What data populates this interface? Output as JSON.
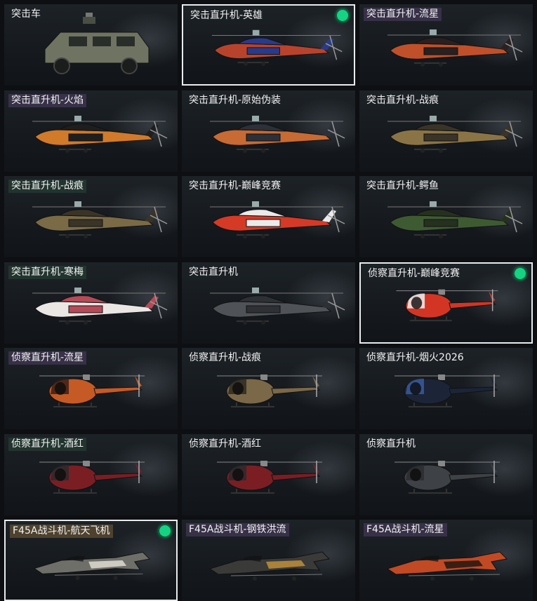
{
  "tiles": [
    {
      "label": "突击车",
      "kind": "truck",
      "tint": "plain",
      "selected": false,
      "badge": false,
      "c1": "#6e7461",
      "c2": "#4a4f43"
    },
    {
      "label": "突击直升机-英雄",
      "kind": "attack",
      "tint": "plain",
      "selected": true,
      "badge": true,
      "c1": "#b8432c",
      "c2": "#2a3a8a"
    },
    {
      "label": "突击直升机-流星",
      "kind": "attack",
      "tint": "purple",
      "selected": false,
      "badge": false,
      "c1": "#c0502a",
      "c2": "#2a2020"
    },
    {
      "label": "突击直升机-火焰",
      "kind": "attack",
      "tint": "purple",
      "selected": false,
      "badge": false,
      "c1": "#d07a2a",
      "c2": "#1e1e1e"
    },
    {
      "label": "突击直升机-原始伪装",
      "kind": "attack",
      "tint": "plain",
      "selected": false,
      "badge": false,
      "c1": "#c76a34",
      "c2": "#2c3038"
    },
    {
      "label": "突击直升机-战痕",
      "kind": "attack",
      "tint": "plain",
      "selected": false,
      "badge": false,
      "c1": "#8a7446",
      "c2": "#3a3428"
    },
    {
      "label": "突击直升机-战痕",
      "kind": "attack",
      "tint": "green",
      "selected": false,
      "badge": false,
      "c1": "#7a6a46",
      "c2": "#3a3428"
    },
    {
      "label": "突击直升机-巅峰竞赛",
      "kind": "attack",
      "tint": "plain",
      "selected": false,
      "badge": false,
      "c1": "#d43a26",
      "c2": "#eaeaea"
    },
    {
      "label": "突击直升机-鳄鱼",
      "kind": "attack",
      "tint": "plain",
      "selected": false,
      "badge": false,
      "c1": "#3e5a32",
      "c2": "#26301f"
    },
    {
      "label": "突击直升机-寒梅",
      "kind": "attack",
      "tint": "green",
      "selected": false,
      "badge": false,
      "c1": "#e9e6e4",
      "c2": "#b64a56"
    },
    {
      "label": "突击直升机",
      "kind": "attack",
      "tint": "plain",
      "selected": false,
      "badge": false,
      "c1": "#4f5358",
      "c2": "#2d3034"
    },
    {
      "label": "侦察直升机-巅峰竞赛",
      "kind": "scout",
      "tint": "plain",
      "selected": true,
      "badge": true,
      "c1": "#d33524",
      "c2": "#f1f1f1"
    },
    {
      "label": "侦察直升机-流星",
      "kind": "scout",
      "tint": "purple",
      "selected": false,
      "badge": false,
      "c1": "#c55a24",
      "c2": "#3a2018"
    },
    {
      "label": "侦察直升机-战痕",
      "kind": "scout",
      "tint": "plain",
      "selected": false,
      "badge": false,
      "c1": "#7b6848",
      "c2": "#2f2a22"
    },
    {
      "label": "侦察直升机-烟火2026",
      "kind": "scout",
      "tint": "plain",
      "selected": false,
      "badge": false,
      "c1": "#1c2438",
      "c2": "#3a5aa0"
    },
    {
      "label": "侦察直升机-酒红",
      "kind": "scout",
      "tint": "green",
      "selected": false,
      "badge": false,
      "c1": "#7a1e24",
      "c2": "#2a2a2c"
    },
    {
      "label": "侦察直升机-酒红",
      "kind": "scout",
      "tint": "plain",
      "selected": false,
      "badge": false,
      "c1": "#7a1e24",
      "c2": "#2a2a2c"
    },
    {
      "label": "侦察直升机",
      "kind": "scout",
      "tint": "plain",
      "selected": false,
      "badge": false,
      "c1": "#3e4247",
      "c2": "#2a2c30"
    },
    {
      "label": "F45A战斗机-航天飞机",
      "kind": "jet",
      "tint": "gold",
      "selected": true,
      "badge": true,
      "c1": "#6f6f69",
      "c2": "#d8d6cc"
    },
    {
      "label": "F45A战斗机-钢铁洪流",
      "kind": "jet",
      "tint": "purple",
      "selected": false,
      "badge": false,
      "c1": "#3a3a38",
      "c2": "#b88b3a"
    },
    {
      "label": "F45A战斗机-流星",
      "kind": "jet",
      "tint": "purple",
      "selected": false,
      "badge": false,
      "c1": "#c14a24",
      "c2": "#2a1a14"
    }
  ]
}
